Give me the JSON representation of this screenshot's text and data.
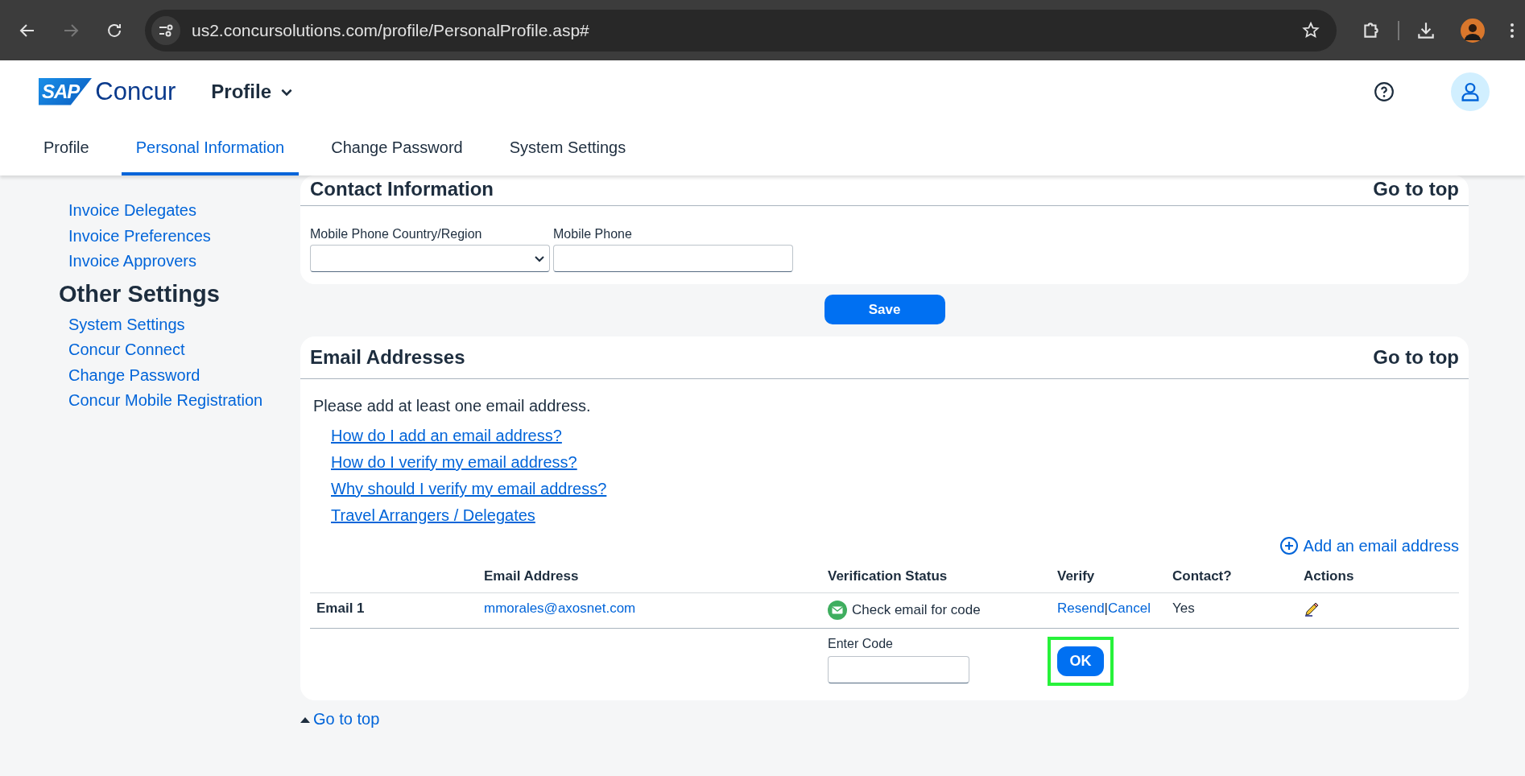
{
  "browser": {
    "url": "us2.concursolutions.com/profile/PersonalProfile.asp#"
  },
  "header": {
    "logo_badge": "SAP",
    "logo_text": "Concur",
    "menu": "Profile"
  },
  "tabs": [
    {
      "label": "Profile",
      "selected": false
    },
    {
      "label": "Personal Information",
      "selected": true
    },
    {
      "label": "Change Password",
      "selected": false
    },
    {
      "label": "System Settings",
      "selected": false
    }
  ],
  "sidebar": {
    "links": [
      "Invoice Delegates",
      "Invoice Preferences",
      "Invoice Approvers"
    ],
    "heading": "Other Settings",
    "other_links": [
      "System Settings",
      "Concur Connect",
      "Change Password",
      "Concur Mobile Registration"
    ]
  },
  "contact": {
    "title": "Contact Information",
    "go_top": "Go to top",
    "country_label": "Mobile Phone Country/Region",
    "phone_label": "Mobile Phone"
  },
  "save": "Save",
  "email": {
    "title": "Email Addresses",
    "go_top": "Go to top",
    "intro": "Please add at least one email address.",
    "help_links": [
      "How do I add an email address?",
      "How do I verify my email address?",
      "Why should I verify my email address?",
      "Travel Arrangers / Delegates"
    ],
    "add": "Add an email address",
    "columns": [
      "Email Address",
      "Verification Status",
      "Verify",
      "Contact?",
      "Actions"
    ],
    "rows": [
      {
        "label": "Email 1",
        "address": "mmorales@axosnet.com",
        "status": "Check email for code",
        "resend": "Resend",
        "separator": "|",
        "cancel": "Cancel",
        "contact": "Yes"
      }
    ],
    "code_label": "Enter Code",
    "ok": {
      "label": "OK",
      "highlighted": true
    }
  },
  "bottom_link": "Go to top"
}
